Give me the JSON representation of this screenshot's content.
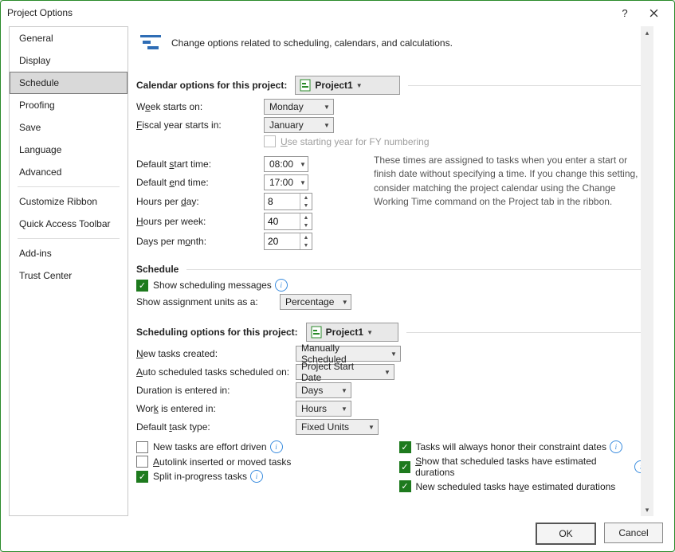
{
  "title": "Project Options",
  "sidebar": {
    "items": [
      "General",
      "Display",
      "Schedule",
      "Proofing",
      "Save",
      "Language",
      "Advanced",
      "Customize Ribbon",
      "Quick Access Toolbar",
      "Add-ins",
      "Trust Center"
    ],
    "selected": 2
  },
  "intro": "Change options related to scheduling, calendars, and calculations.",
  "calOpts": {
    "header": "Calendar options for this project:",
    "project": "Project1",
    "weekStartsLabelPre": "W",
    "weekStartsLabelU": "e",
    "weekStartsLabelPost": "ek starts on:",
    "weekStarts": "Monday",
    "fyLabelPre": "",
    "fyLabelU": "F",
    "fyLabelPost": "iscal year starts in:",
    "fyStarts": "January",
    "fyChkPre": "",
    "fyChkU": "U",
    "fyChkPost": "se starting year for FY numbering",
    "dstartPre": "Default ",
    "dstartU": "s",
    "dstartPost": "tart time:",
    "dstart": "08:00",
    "dendPre": "Default ",
    "dendU": "e",
    "dendPost": "nd time:",
    "dend": "17:00",
    "hpdPre": "Hours per ",
    "hpdU": "d",
    "hpdPost": "ay:",
    "hpd": "8",
    "hpwPre": "",
    "hpwU": "H",
    "hpwPost": "ours per week:",
    "hpw": "40",
    "dpmPre": "Days per m",
    "dpmU": "o",
    "dpmPost": "nth:",
    "dpm": "20",
    "hint": "These times are assigned to tasks when you enter a start or finish date without specifying a time. If you change this setting, consider matching the project calendar using the Change Working Time command on the Project tab in the ribbon."
  },
  "schedule": {
    "header": "Schedule",
    "showMsgs": "Show scheduling messages",
    "assignLabel": "Show assignment units as a:",
    "assignVal": "Percentage"
  },
  "schedOpts": {
    "header": "Scheduling options for this project:",
    "project": "Project1",
    "newTasksPre": "",
    "newTasksU": "N",
    "newTasksPost": "ew tasks created:",
    "newTasksVal": "Manually Scheduled",
    "autoPre": "",
    "autoU": "A",
    "autoPost": "uto scheduled tasks scheduled on:",
    "autoVal": "Project Start Date",
    "durLabel": "Duration is entered in:",
    "durVal": "Days",
    "workPre": "Wor",
    "workU": "k",
    "workPost": " is entered in:",
    "workVal": "Hours",
    "defTypePre": "Default ",
    "defTypeU": "t",
    "defTypePost": "ask type:",
    "defTypeVal": "Fixed Units",
    "c1": "New tasks are effort driven",
    "c2Pre": "",
    "c2U": "A",
    "c2Post": "utolink inserted or moved tasks",
    "c3": "Split in-progress tasks",
    "c4": "Tasks will always honor their constraint dates",
    "c5Pre": "",
    "c5U": "S",
    "c5Post": "how that scheduled tasks have estimated durations",
    "c6Pre": "New scheduled tasks ha",
    "c6U": "v",
    "c6Post": "e estimated durations"
  },
  "buttons": {
    "ok": "OK",
    "cancel": "Cancel"
  }
}
